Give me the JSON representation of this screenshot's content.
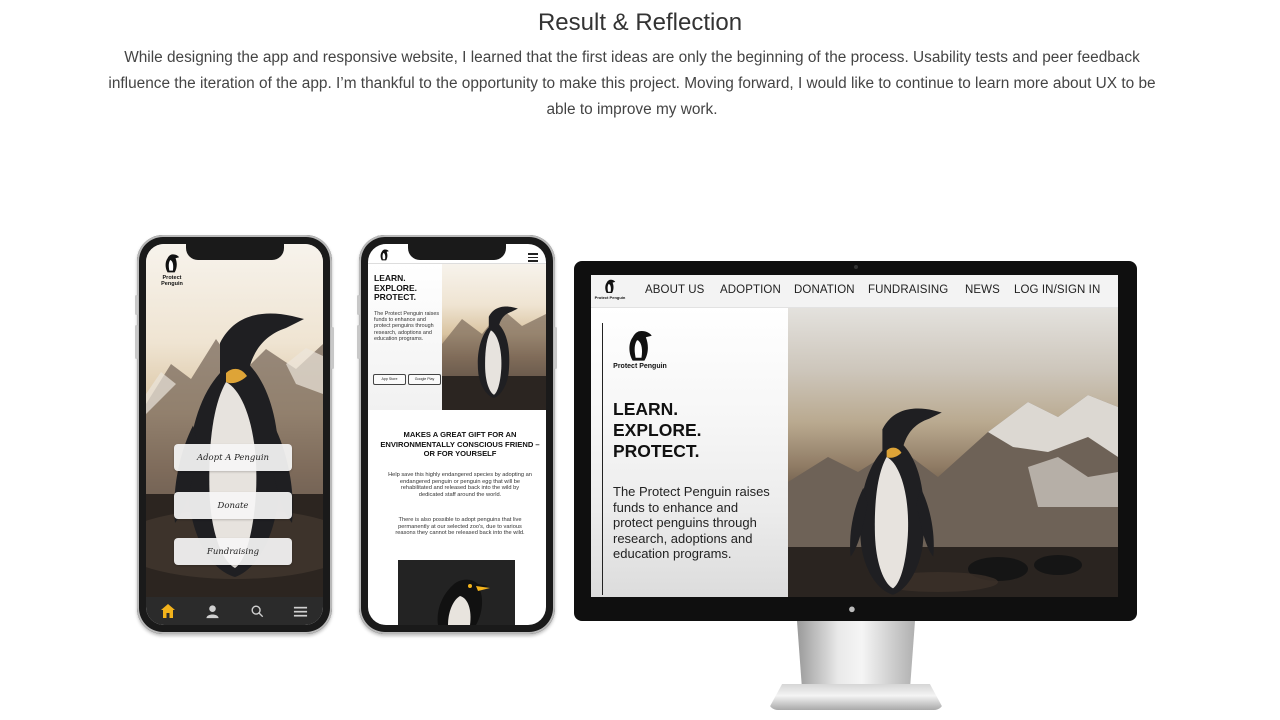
{
  "section": {
    "title": "Result & Reflection",
    "body": "While designing the app and responsive website, I learned that the first ideas are only the beginning of the process. Usability tests and peer feedback influence the iteration of the app. I’m thankful to the opportunity to make this project. Moving forward, I would like to continue to learn more about UX to be able to improve my work."
  },
  "brand": {
    "name": "Protect Penguin",
    "accent": "#f2b21b"
  },
  "app": {
    "buttons": [
      "Adopt A Penguin",
      "Donate",
      "Fundraising"
    ],
    "tabs": [
      "home-icon",
      "profile-icon",
      "search-icon",
      "menu-icon"
    ]
  },
  "mobile_web": {
    "hero_title": "LEARN.\nEXPLORE.\nPROTECT.",
    "hero_body": "The Protect Penguin raises funds to enhance and protect penguins through research, adoptions and education programs.",
    "store_badges": [
      "App Store",
      "Google Play"
    ],
    "gift_heading": "MAKES A GREAT GIFT FOR AN ENVIRONMENTALLY CONSCIOUS FRIEND – OR FOR YOURSELF",
    "gift_p1": "Help save this highly endangered species by adopting an endangered penguin or penguin egg that will be rehabilitated and released back into the wild by dedicated staff around the world.",
    "gift_p2": "There is also possible to adopt penguins that live permanently at our selected zoo's, due to various reasons they cannot be released back into the wild."
  },
  "desktop": {
    "nav": [
      "ABOUT US",
      "ADOPTION",
      "DONATION",
      "FUNDRAISING",
      "NEWS",
      "LOG IN/SIGN IN"
    ],
    "hero_title": "LEARN.\nEXPLORE.\nPROTECT.",
    "hero_body": "The Protect Penguin raises funds to enhance and protect penguins through research, adoptions and education programs."
  }
}
